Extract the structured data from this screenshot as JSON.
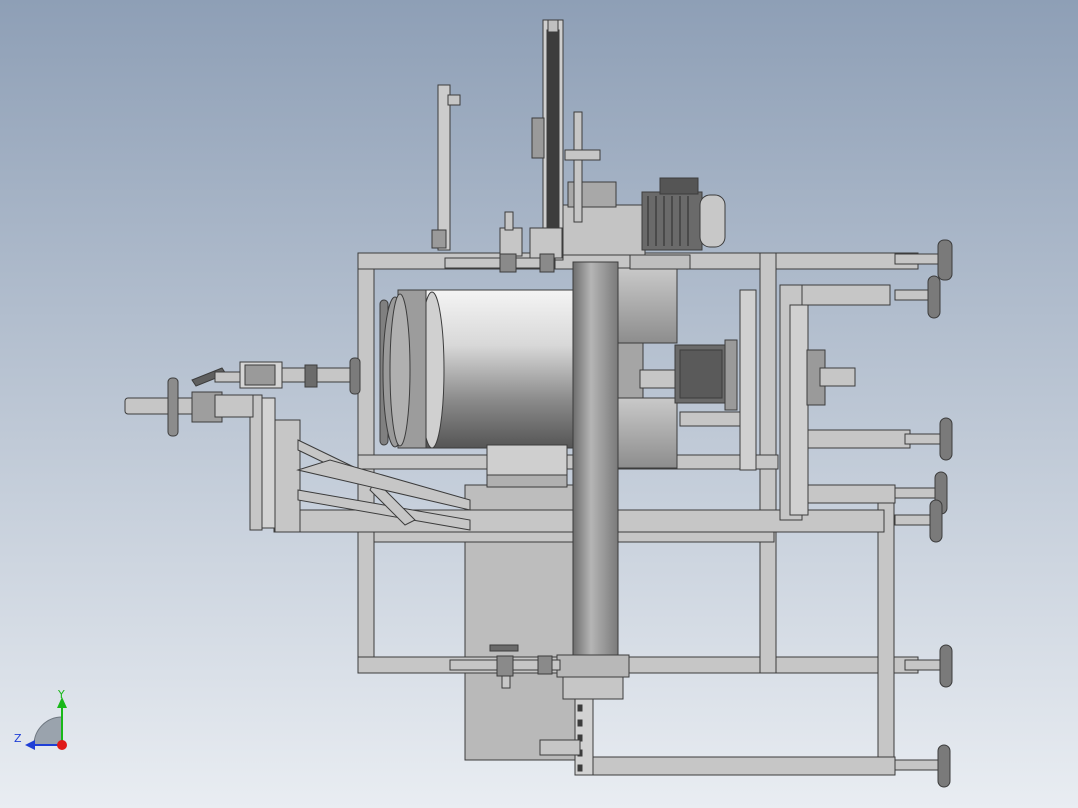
{
  "viewport": {
    "background_top": "#8e9fb6",
    "background_bottom": "#e9edf2"
  },
  "colors": {
    "frame_fill": "#c6c6c6",
    "frame_stroke": "#3c3c3c",
    "part_dark": "#4a4a4a",
    "motor_body": "#6a6a6a",
    "triad_x": "#e01919",
    "triad_y": "#19b819",
    "triad_z": "#1f3fd6"
  },
  "triad": {
    "x_label": "",
    "y_label": "Y",
    "z_label": "Z"
  }
}
